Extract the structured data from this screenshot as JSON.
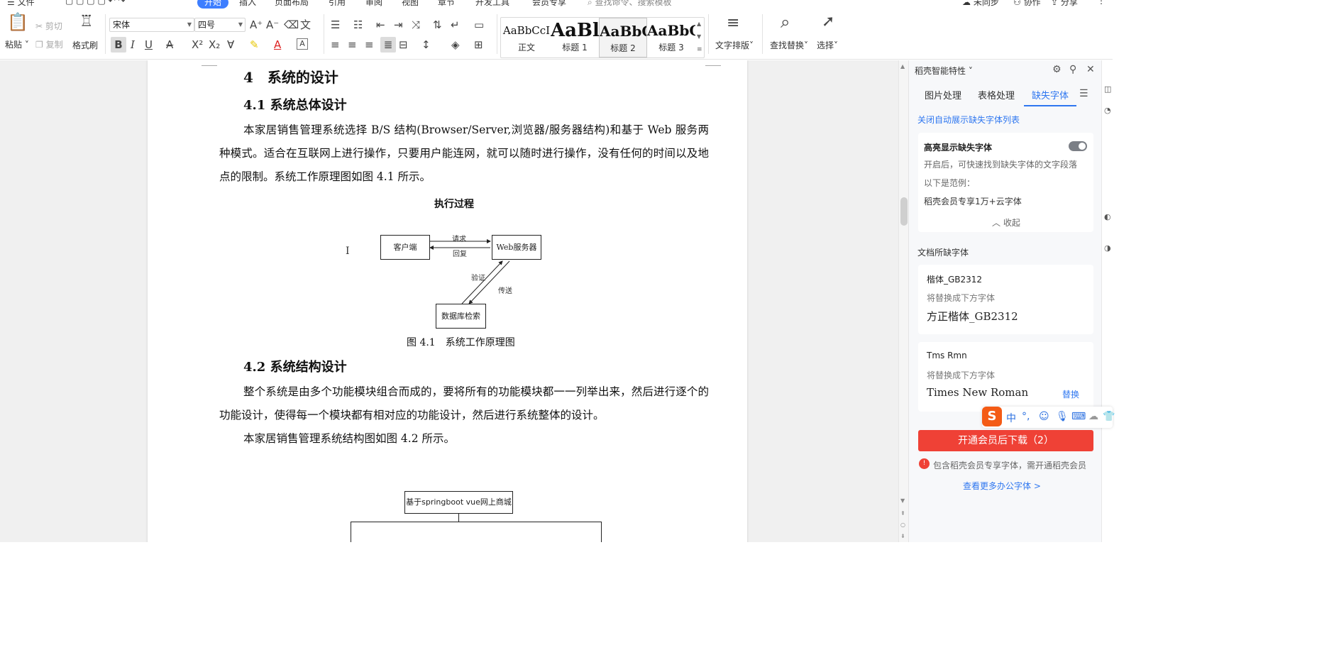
{
  "menu": {
    "file": "文件",
    "start": "开始",
    "insert": "插入",
    "layout": "页面布局",
    "reference": "引用",
    "review": "审阅",
    "view": "视图",
    "chapter": "章节",
    "devtools": "开发工具",
    "member": "会员专享",
    "search_placeholder": "查找命令、搜索模板",
    "sync": "未同步",
    "collab": "协作",
    "share": "分享"
  },
  "ribbon": {
    "paste": "粘贴",
    "cut": "剪切",
    "copy": "复制",
    "format_painter": "格式刷",
    "font_name": "宋体",
    "font_size": "四号",
    "styles": [
      {
        "sample": "AaBbCcI",
        "name": "正文"
      },
      {
        "sample": "AaBl",
        "name": "标题 1"
      },
      {
        "sample": "AaBbC",
        "name": "标题 2"
      },
      {
        "sample": "AaBbC",
        "name": "标题 3"
      }
    ],
    "text_layout": "文字排版",
    "find_replace": "查找替换",
    "select": "选择"
  },
  "document": {
    "h1": "4　系统的设计",
    "h2_1": "4.1  系统总体设计",
    "p1": "本家居销售管理系统选择 B/S 结构(Browser/Server,浏览器/服务器结构)和基于 Web 服务两种模式。适合在互联网上进行操作，只要用户能连网，就可以随时进行操作，没有任何的时间以及地点的限制。系统工作原理图如图 4.1 所示。",
    "diagram": {
      "title": "执行过程",
      "client": "客户端",
      "server": "Web服务器",
      "db": "数据库检索",
      "request": "请求",
      "reply": "回复",
      "verify": "验证",
      "transfer": "传送"
    },
    "fig1_caption": "图 4.1　系统工作原理图",
    "h2_2": "4.2  系统结构设计",
    "p2": "整个系统是由多个功能模块组合而成的，要将所有的功能模块都一一列举出来，然后进行逐个的功能设计，使得每一个模块都有相对应的功能设计，然后进行系统整体的设计。",
    "p3": "本家居销售管理系统结构图如图 4.2 所示。",
    "struct_root": "基于springboot vue网上商城"
  },
  "panel": {
    "title": "稻壳智能特性",
    "tabs": [
      "图片处理",
      "表格处理",
      "缺失字体"
    ],
    "close_auto_link": "关闭自动展示缺失字体列表",
    "highlight_title": "高亮显示缺失字体",
    "highlight_desc": "开启后，可快速找到缺失字体的文字段落",
    "example_label": "以下是范例：",
    "example_text": "稻壳会员专享1万+云字体",
    "collapse": "收起",
    "missing_title": "文档所缺字体",
    "fonts": [
      {
        "name": "楷体_GB2312",
        "sub": "将替换成下方字体",
        "replacement": "方正楷体_GB2312",
        "action": ""
      },
      {
        "name": "Tms Rmn",
        "sub": "将替换成下方字体",
        "replacement": "Times New Roman",
        "action": "替换"
      }
    ],
    "download_btn": "开通会员后下载（2）",
    "member_note": "包含稻壳会员专享字体，需开通稻壳会员",
    "more_link": "查看更多办公字体 >"
  },
  "ime": {
    "logo": "S",
    "lang": "中"
  },
  "colors": {
    "accent": "#3d7eff",
    "link": "#2f77f0",
    "danger": "#ef4136"
  }
}
